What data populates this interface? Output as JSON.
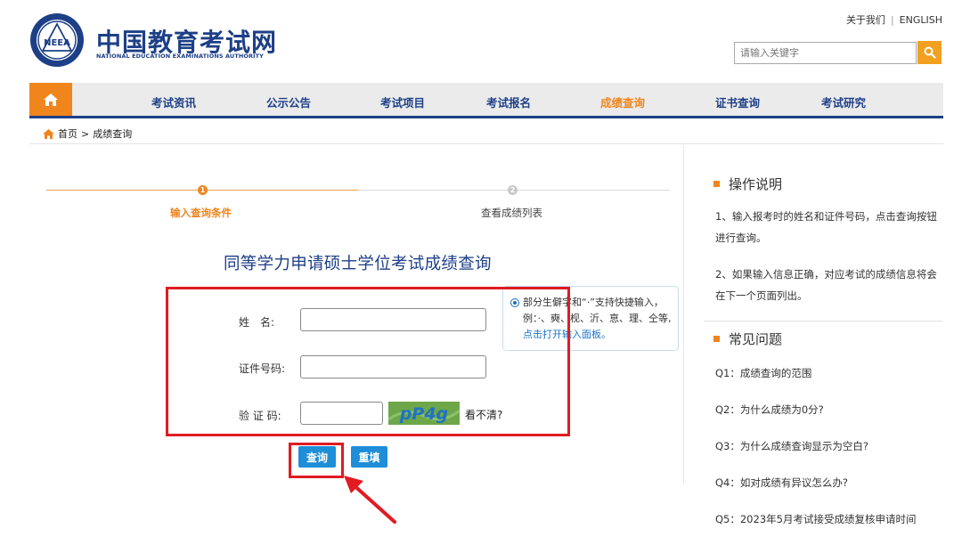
{
  "header": {
    "logo_cn": "中国教育考试网",
    "logo_en": "NATIONAL EDUCATION EXAMINATIONS AUTHORITY",
    "logo_seal_text": "NEEA",
    "top_links": {
      "about": "关于我们",
      "separator": "|",
      "english": "ENGLISH"
    },
    "search": {
      "placeholder": "请输入关键字"
    }
  },
  "nav": {
    "items": [
      {
        "label": "考试资讯"
      },
      {
        "label": "公示公告"
      },
      {
        "label": "考试项目"
      },
      {
        "label": "考试报名"
      },
      {
        "label": "成绩查询",
        "active": true
      },
      {
        "label": "证书查询"
      },
      {
        "label": "考试研究"
      }
    ]
  },
  "breadcrumb": {
    "home": "首页",
    "separator": ">",
    "current": "成绩查询"
  },
  "steps": [
    {
      "number": "1",
      "label": "输入查询条件",
      "active": true
    },
    {
      "number": "2",
      "label": "查看成绩列表",
      "active": false
    }
  ],
  "form": {
    "title": "同等学力申请硕士学位考试成绩查询",
    "name_label": "姓　名:",
    "name_value": "",
    "id_label": "证件号码:",
    "id_value": "",
    "captcha_label": "验 证 码:",
    "captcha_value": "",
    "captcha_image_text": "pP4g",
    "captcha_refresh": "看不清?",
    "tip_text": "部分生僻字和“·”支持快捷输入，例：·、奭、枧、沂、恴、理、仝等,",
    "tip_link": "点击打开输入面板。",
    "query_button": "查询",
    "reset_button": "重填"
  },
  "sidebar": {
    "instructions_title": "操作说明",
    "instructions": [
      "1、输入报考时的姓名和证件号码，点击查询按钮进行查询。",
      "2、如果输入信息正确，对应考试的成绩信息将会在下一个页面列出。"
    ],
    "faq_title": "常见问题",
    "faq": [
      "Q1：成绩查询的范围",
      "Q2：为什么成绩为0分?",
      "Q3：为什么成绩查询显示为空白?",
      "Q4：如对成绩有异议怎么办?",
      "Q5：2023年5月考试接受成绩复核申请时间"
    ]
  },
  "colors": {
    "brand_blue": "#1d3f87",
    "accent_orange": "#f0851e",
    "button_blue": "#1f8ed8",
    "annotation_red": "#e11b22"
  }
}
